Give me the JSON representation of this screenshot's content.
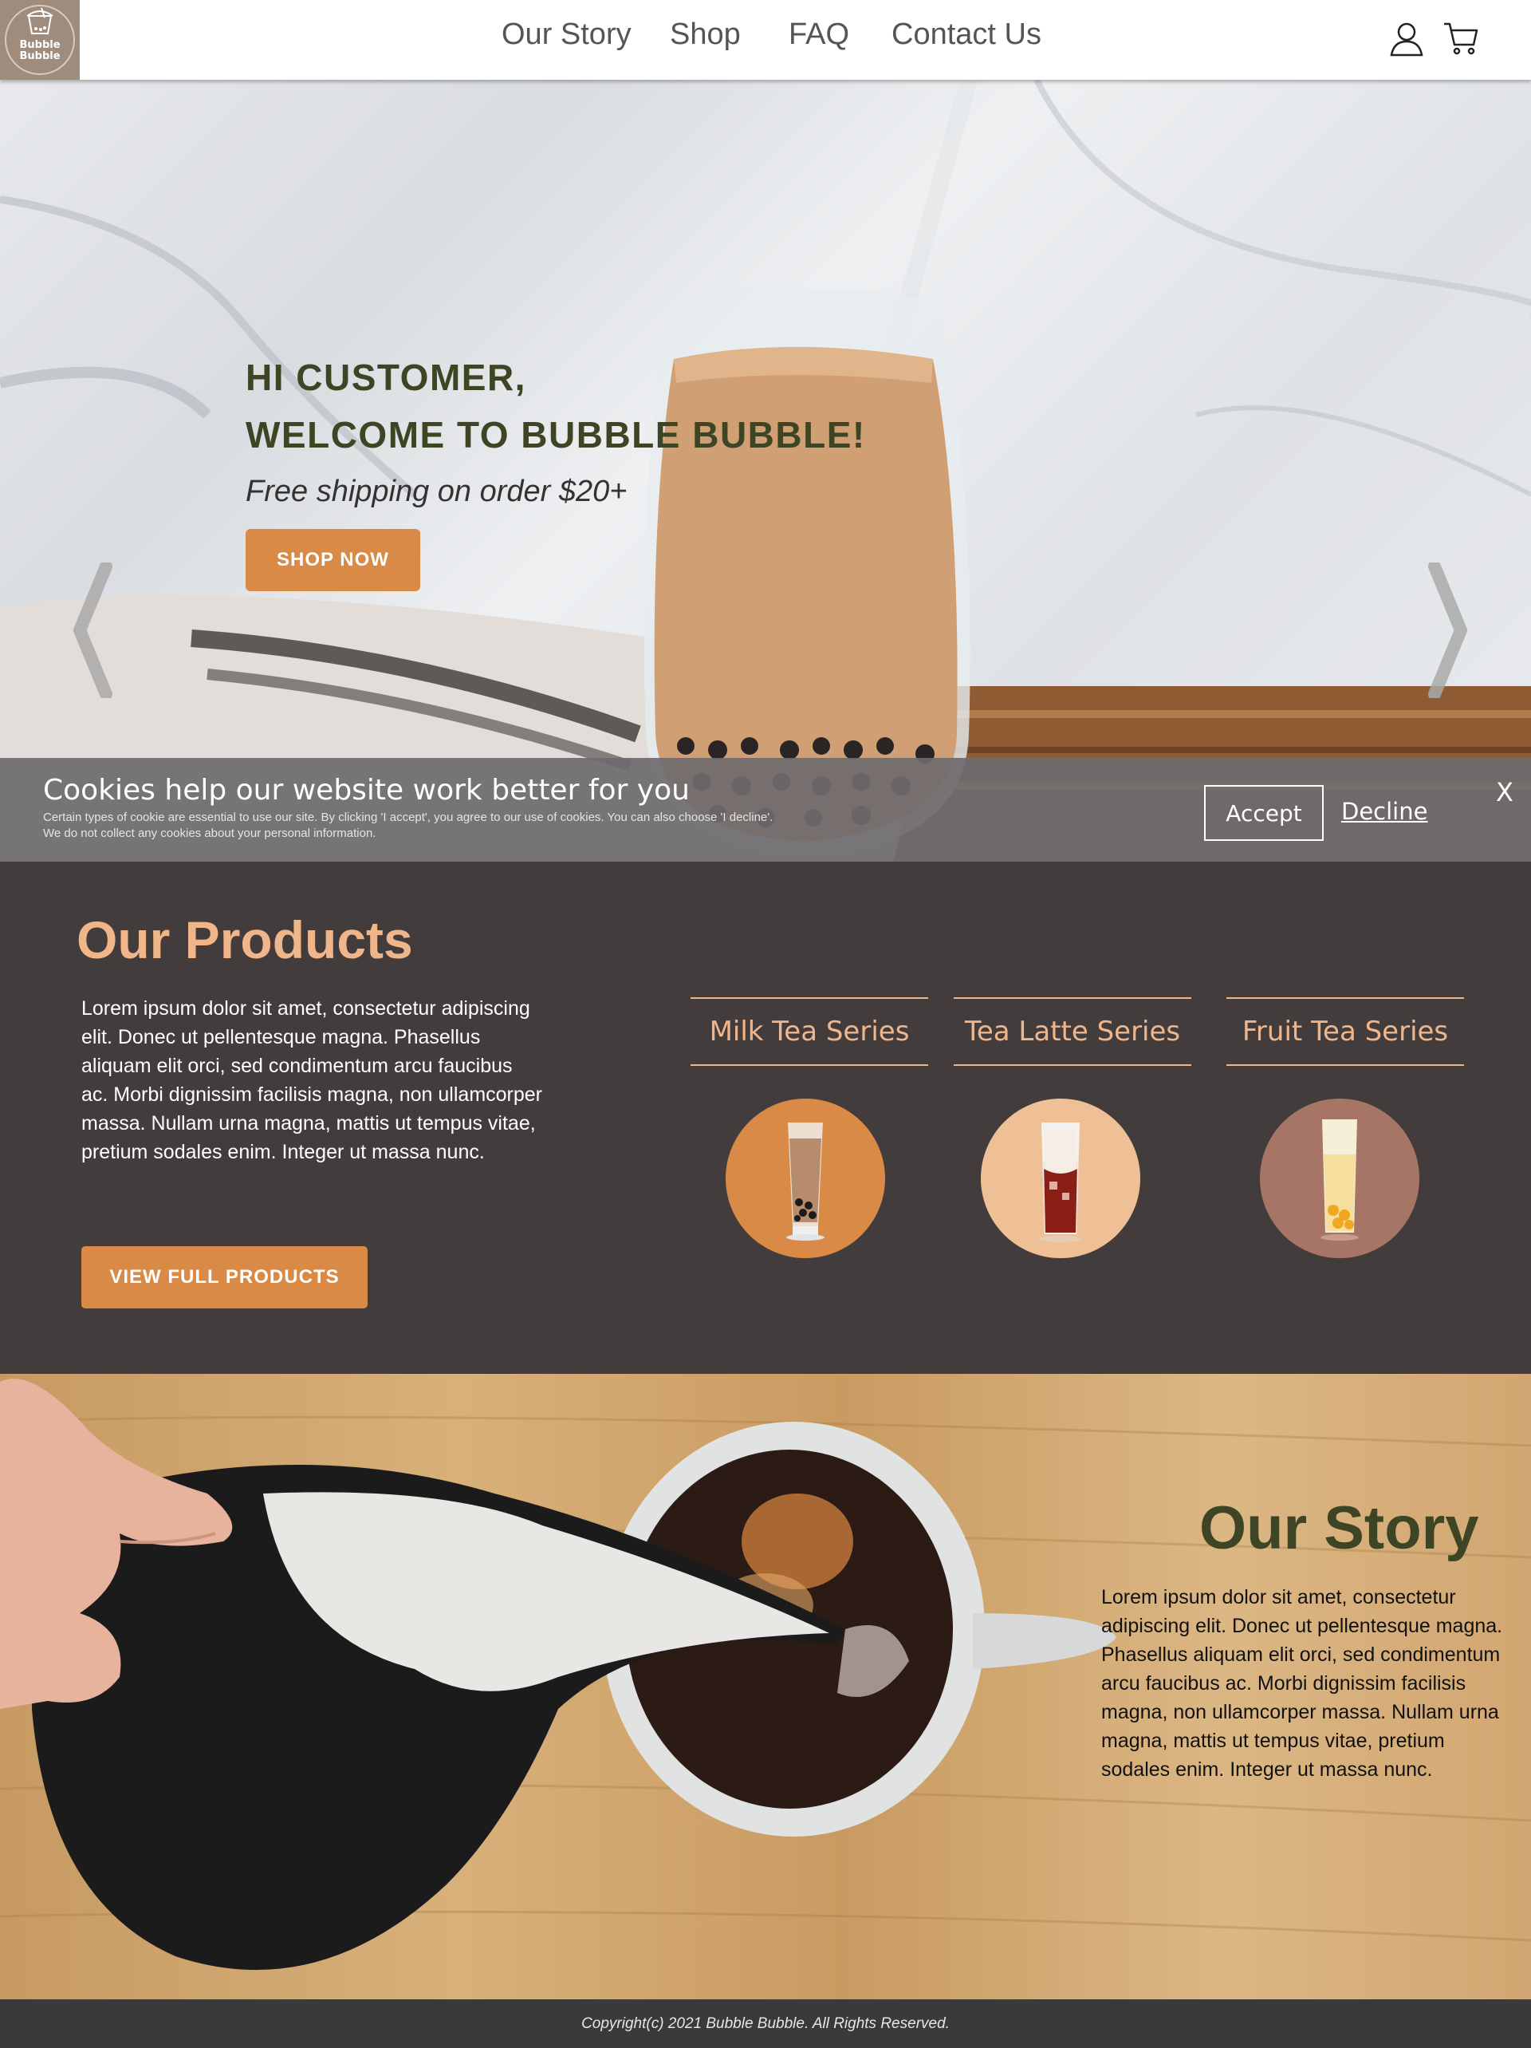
{
  "brand": {
    "logo_line1": "Bubble",
    "logo_line2": "Bubble"
  },
  "nav": {
    "items": [
      "Our Story",
      "Shop",
      "FAQ",
      "Contact Us"
    ]
  },
  "header_icons": {
    "account": "user-icon",
    "cart": "cart-icon"
  },
  "hero": {
    "greeting": "HI CUSTOMER,",
    "welcome": "WELCOME TO BUBBLE BUBBLE!",
    "subtitle": "Free shipping on order $20+",
    "cta_label": "SHOP NOW",
    "prev_icon": "chevron-left-icon",
    "next_icon": "chevron-right-icon"
  },
  "cookie": {
    "title": "Cookies help our website work better for you",
    "text_line1": "Certain types of cookie are essential to use our site. By clicking 'I accept', you agree to our use of cookies. You can also choose 'I decline'.",
    "text_line2": "We do not collect any cookies about your personal information.",
    "accept_label": "Accept",
    "decline_label": "Decline",
    "close_label": "X"
  },
  "products": {
    "title": "Our Products",
    "description": "Lorem ipsum dolor sit amet, consectetur adipiscing elit. Donec ut pellentesque magna. Phasellus aliquam elit orci, sed condimentum arcu faucibus ac. Morbi dignissim facilisis magna, non ullamcorper massa. Nullam urna magna, mattis ut tempus vitae, pretium sodales enim. Integer ut massa nunc.",
    "cta_label": "VIEW FULL PRODUCTS",
    "series": [
      {
        "label": "Milk Tea Series",
        "color": "#d98a46"
      },
      {
        "label": "Tea Latte Series",
        "color": "#efc095"
      },
      {
        "label": "Fruit Tea Series",
        "color": "#a67565"
      }
    ]
  },
  "story": {
    "title": "Our Story",
    "description": "Lorem ipsum dolor sit amet, consectetur adipiscing elit. Donec ut pellentesque magna. Phasellus aliquam elit orci, sed condimentum arcu faucibus ac. Morbi dignissim facilisis magna, non ullamcorper massa. Nullam urna magna, mattis ut tempus vitae, pretium sodales enim. Integer ut massa nunc."
  },
  "footer": {
    "copyright": "Copyright(c) 2021 Bubble Bubble. All Rights Reserved."
  },
  "colors": {
    "accent": "#d98a46",
    "heading_olive": "#3d4525",
    "products_bg": "#433c3d",
    "products_heading": "#f0b68a"
  }
}
